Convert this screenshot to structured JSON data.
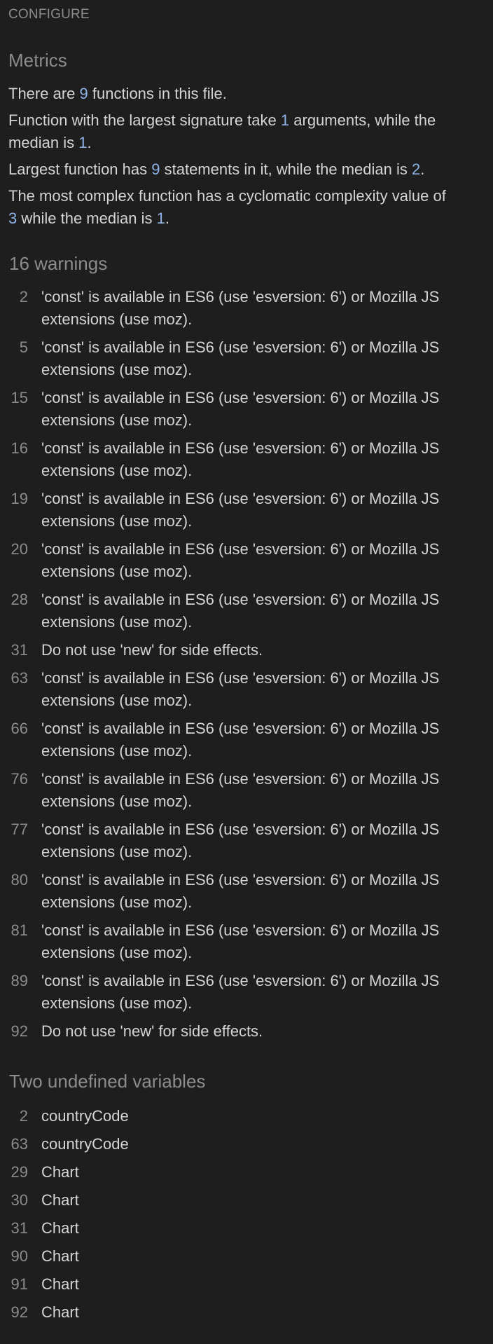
{
  "configure_label": "CONFIGURE",
  "metrics": {
    "title": "Metrics",
    "line1": {
      "pre": "There are ",
      "num": "9",
      "post": " functions in this file."
    },
    "line2": {
      "pre": "Function with the largest signature take ",
      "num1": "1",
      "mid": " arguments, while the median is ",
      "num2": "1",
      "post": "."
    },
    "line3": {
      "pre": "Largest function has ",
      "num1": "9",
      "mid": " statements in it, while the median is ",
      "num2": "2",
      "post": "."
    },
    "line4": {
      "pre": "The most complex function has a cyclomatic complexity value of ",
      "num1": "3",
      "mid": " while the median is ",
      "num2": "1",
      "post": "."
    }
  },
  "warnings": {
    "title": "16 warnings",
    "items": [
      {
        "line": "2",
        "message": "'const' is available in ES6 (use 'esversion: 6') or Mozilla JS extensions (use moz)."
      },
      {
        "line": "5",
        "message": "'const' is available in ES6 (use 'esversion: 6') or Mozilla JS extensions (use moz)."
      },
      {
        "line": "15",
        "message": "'const' is available in ES6 (use 'esversion: 6') or Mozilla JS extensions (use moz)."
      },
      {
        "line": "16",
        "message": "'const' is available in ES6 (use 'esversion: 6') or Mozilla JS extensions (use moz)."
      },
      {
        "line": "19",
        "message": "'const' is available in ES6 (use 'esversion: 6') or Mozilla JS extensions (use moz)."
      },
      {
        "line": "20",
        "message": "'const' is available in ES6 (use 'esversion: 6') or Mozilla JS extensions (use moz)."
      },
      {
        "line": "28",
        "message": "'const' is available in ES6 (use 'esversion: 6') or Mozilla JS extensions (use moz)."
      },
      {
        "line": "31",
        "message": "Do not use 'new' for side effects."
      },
      {
        "line": "63",
        "message": "'const' is available in ES6 (use 'esversion: 6') or Mozilla JS extensions (use moz)."
      },
      {
        "line": "66",
        "message": "'const' is available in ES6 (use 'esversion: 6') or Mozilla JS extensions (use moz)."
      },
      {
        "line": "76",
        "message": "'const' is available in ES6 (use 'esversion: 6') or Mozilla JS extensions (use moz)."
      },
      {
        "line": "77",
        "message": "'const' is available in ES6 (use 'esversion: 6') or Mozilla JS extensions (use moz)."
      },
      {
        "line": "80",
        "message": "'const' is available in ES6 (use 'esversion: 6') or Mozilla JS extensions (use moz)."
      },
      {
        "line": "81",
        "message": "'const' is available in ES6 (use 'esversion: 6') or Mozilla JS extensions (use moz)."
      },
      {
        "line": "89",
        "message": "'const' is available in ES6 (use 'esversion: 6') or Mozilla JS extensions (use moz)."
      },
      {
        "line": "92",
        "message": "Do not use 'new' for side effects."
      }
    ]
  },
  "undefined_variables": {
    "title": "Two undefined variables",
    "items": [
      {
        "line": "2",
        "name": "countryCode"
      },
      {
        "line": "63",
        "name": "countryCode"
      },
      {
        "line": "29",
        "name": "Chart"
      },
      {
        "line": "30",
        "name": "Chart"
      },
      {
        "line": "31",
        "name": "Chart"
      },
      {
        "line": "90",
        "name": "Chart"
      },
      {
        "line": "91",
        "name": "Chart"
      },
      {
        "line": "92",
        "name": "Chart"
      }
    ]
  }
}
